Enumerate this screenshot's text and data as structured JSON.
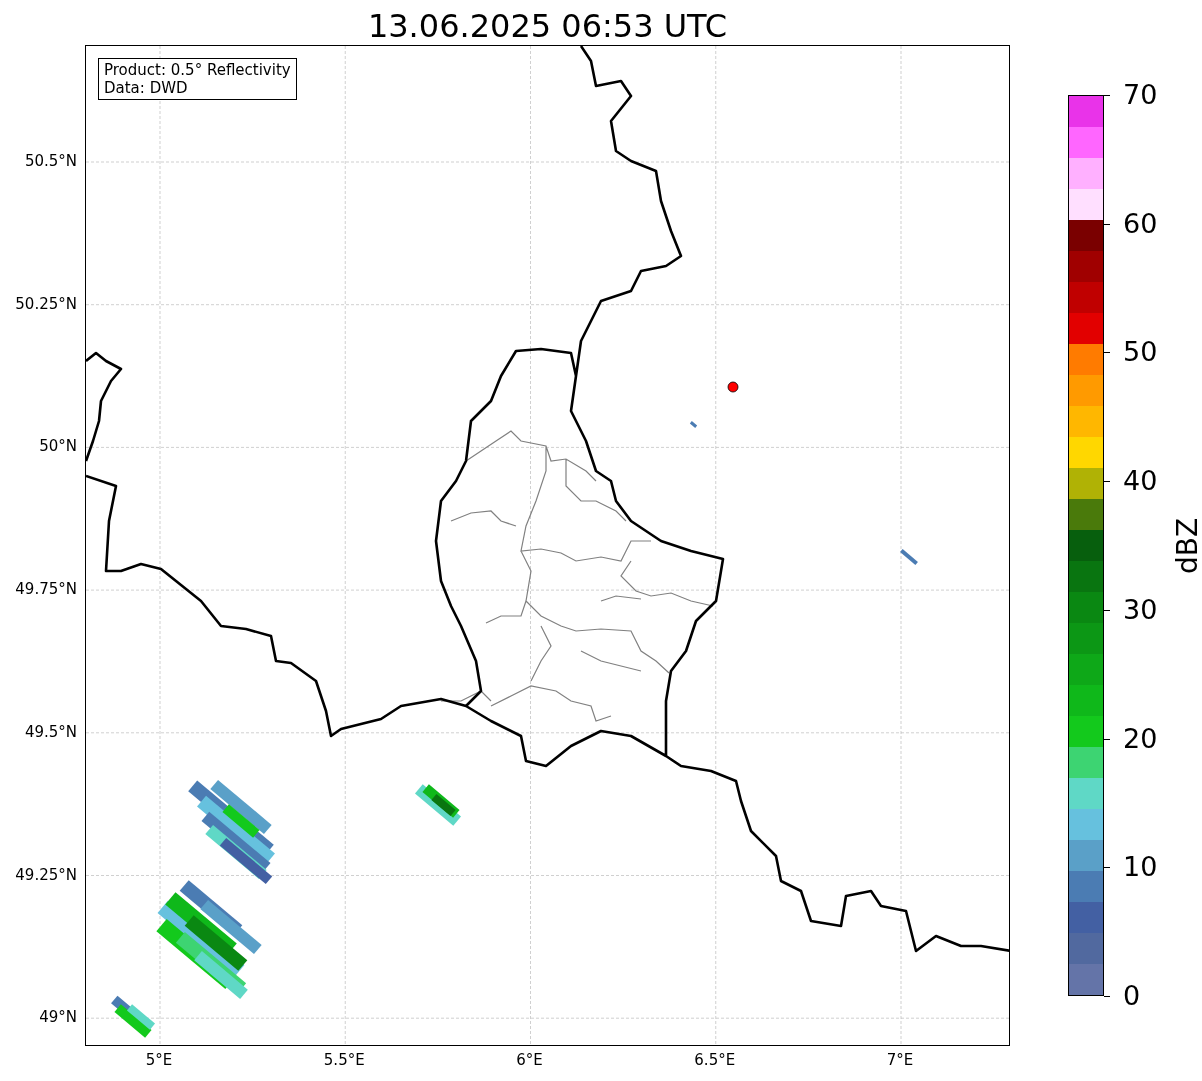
{
  "title": "13.06.2025 06:53 UTC",
  "info_box": [
    "Product: 0.5° Reflectivity",
    "Data: DWD"
  ],
  "map": {
    "lat_labels": [
      "50.5°N",
      "50.25°N",
      "50°N",
      "49.75°N",
      "49.5°N",
      "49.25°N",
      "49°N"
    ],
    "lon_labels": [
      "5°E",
      "5.5°E",
      "6°E",
      "6.5°E",
      "7°E"
    ]
  },
  "colorbar": {
    "label": "dBZ",
    "ticks": [
      "70",
      "60",
      "50",
      "40",
      "30",
      "20",
      "10",
      "0"
    ],
    "segments": [
      {
        "color": "#e933e9"
      },
      {
        "color": "#ff66ff"
      },
      {
        "color": "#ffb0ff"
      },
      {
        "color": "#ffdfff"
      },
      {
        "color": "#7a0000"
      },
      {
        "color": "#a00000"
      },
      {
        "color": "#c00000"
      },
      {
        "color": "#e20000"
      },
      {
        "color": "#ff7b00"
      },
      {
        "color": "#ff9a00"
      },
      {
        "color": "#ffb700"
      },
      {
        "color": "#ffd700"
      },
      {
        "color": "#b0b205"
      },
      {
        "color": "#4a7a0b"
      },
      {
        "color": "#075f0d"
      },
      {
        "color": "#097510"
      },
      {
        "color": "#0a8812"
      },
      {
        "color": "#0c9715"
      },
      {
        "color": "#0ea818"
      },
      {
        "color": "#0fb81a"
      },
      {
        "color": "#13c91c"
      },
      {
        "color": "#3dd472"
      },
      {
        "color": "#5fd8c6"
      },
      {
        "color": "#66c1de"
      },
      {
        "color": "#5aa0c8"
      },
      {
        "color": "#4b7cb3"
      },
      {
        "color": "#4360a3"
      },
      {
        "color": "#51699f"
      },
      {
        "color": "#6474a8"
      }
    ]
  }
}
